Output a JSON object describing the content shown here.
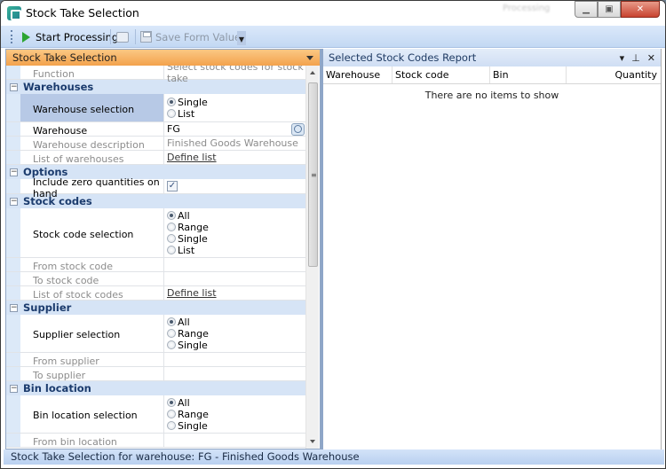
{
  "window": {
    "title": "Stock Take Selection",
    "background_title": "Processing"
  },
  "toolbar": {
    "start": "Start Processing",
    "save": "Save Form Values"
  },
  "left_panel": {
    "title": "Stock Take Selection",
    "function_label": "Function",
    "function_value": "Select stock codes for stock take",
    "warehouses": {
      "header": "Warehouses",
      "selection_label": "Warehouse selection",
      "options": [
        "Single",
        "List"
      ],
      "selected": "Single",
      "warehouse_label": "Warehouse",
      "warehouse_value": "FG",
      "desc_label": "Warehouse description",
      "desc_value": "Finished Goods Warehouse",
      "list_label": "List of warehouses",
      "list_link": "Define list"
    },
    "options": {
      "header": "Options",
      "zero_label": "Include zero quantities on hand",
      "zero_checked": true,
      "check_glyph": "✓"
    },
    "stock_codes": {
      "header": "Stock codes",
      "selection_label": "Stock code selection",
      "options": [
        "All",
        "Range",
        "Single",
        "List"
      ],
      "selected": "All",
      "from_label": "From stock code",
      "to_label": "To stock code",
      "list_label": "List of stock codes",
      "list_link": "Define list"
    },
    "supplier": {
      "header": "Supplier",
      "selection_label": "Supplier selection",
      "options": [
        "All",
        "Range",
        "Single"
      ],
      "selected": "All",
      "from_label": "From supplier",
      "to_label": "To supplier"
    },
    "bin": {
      "header": "Bin location",
      "selection_label": "Bin location selection",
      "options": [
        "All",
        "Range",
        "Single"
      ],
      "selected": "All",
      "from_label": "From bin location"
    }
  },
  "right_panel": {
    "title": "Selected Stock Codes Report",
    "columns": [
      "Warehouse",
      "Stock code",
      "Bin",
      "Quantity"
    ],
    "empty": "There are no items to show"
  },
  "status": "Stock Take Selection for warehouse: FG - Finished Goods Warehouse"
}
